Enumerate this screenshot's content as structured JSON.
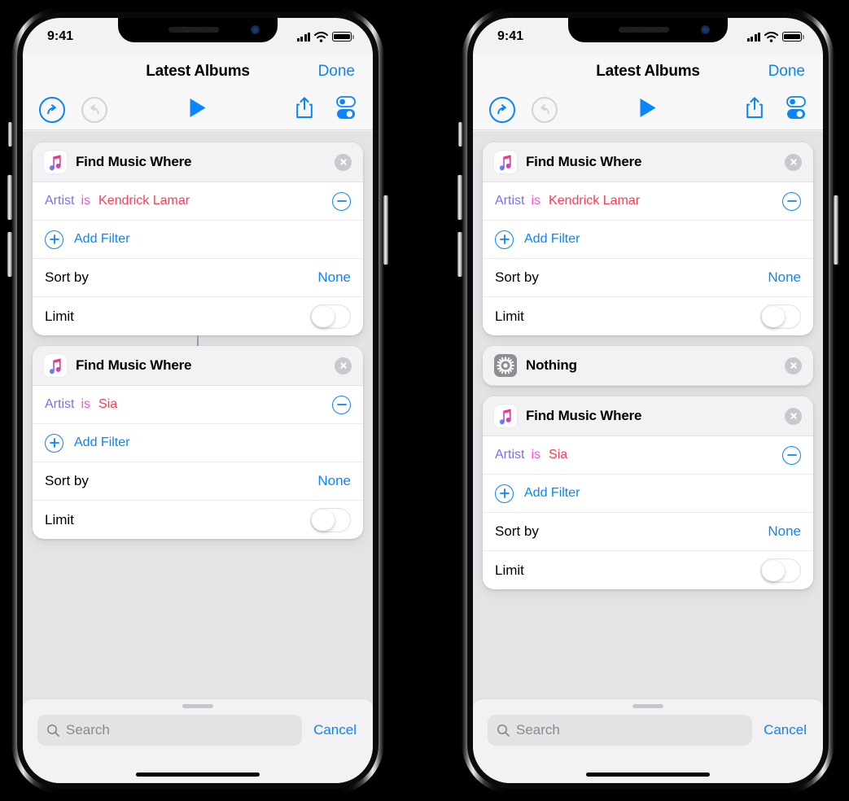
{
  "phones": [
    {
      "id": "left",
      "status_bar": {
        "time": "9:41",
        "cellular": "signal-bars-icon",
        "wifi": "wifi-icon",
        "battery": "battery-full-icon"
      },
      "nav": {
        "title": "Latest Albums",
        "done_label": "Done"
      },
      "toolbar": {
        "undo": "undo-icon",
        "redo": "redo-icon",
        "play": "play-icon",
        "share": "share-icon",
        "settings": "toggles-icon"
      },
      "cards": [
        {
          "type": "music",
          "icon": "apple-music-icon",
          "title": "Find Music Where",
          "close": "close-icon",
          "filters": [
            {
              "attribute": "Artist",
              "operator": "is",
              "value": "Kendrick Lamar",
              "remove": "minus-icon"
            }
          ],
          "add_filter": {
            "icon": "plus-icon",
            "label": "Add Filter"
          },
          "sort": {
            "label": "Sort by",
            "value": "None"
          },
          "limit": {
            "label": "Limit",
            "toggle": "off"
          },
          "connector_below": true
        },
        {
          "type": "music",
          "icon": "apple-music-icon",
          "title": "Find Music Where",
          "close": "close-icon",
          "filters": [
            {
              "attribute": "Artist",
              "operator": "is",
              "value": "Sia",
              "remove": "minus-icon"
            }
          ],
          "add_filter": {
            "icon": "plus-icon",
            "label": "Add Filter"
          },
          "sort": {
            "label": "Sort by",
            "value": "None"
          },
          "limit": {
            "label": "Limit",
            "toggle": "off"
          },
          "connector_below": false
        }
      ],
      "bottom": {
        "search_placeholder": "Search",
        "search_icon": "search-icon",
        "cancel_label": "Cancel",
        "grabber": "drag-handle"
      }
    },
    {
      "id": "right",
      "status_bar": {
        "time": "9:41",
        "cellular": "signal-bars-icon",
        "wifi": "wifi-icon",
        "battery": "battery-full-icon"
      },
      "nav": {
        "title": "Latest Albums",
        "done_label": "Done"
      },
      "toolbar": {
        "undo": "undo-icon",
        "redo": "redo-icon",
        "play": "play-icon",
        "share": "share-icon",
        "settings": "toggles-icon"
      },
      "cards": [
        {
          "type": "music",
          "icon": "apple-music-icon",
          "title": "Find Music Where",
          "close": "close-icon",
          "filters": [
            {
              "attribute": "Artist",
              "operator": "is",
              "value": "Kendrick Lamar",
              "remove": "minus-icon"
            }
          ],
          "add_filter": {
            "icon": "plus-icon",
            "label": "Add Filter"
          },
          "sort": {
            "label": "Sort by",
            "value": "None"
          },
          "limit": {
            "label": "Limit",
            "toggle": "off"
          },
          "connector_below": false
        },
        {
          "type": "nothing",
          "icon": "gear-icon",
          "title": "Nothing",
          "close": "close-icon",
          "connector_below": false
        },
        {
          "type": "music",
          "icon": "apple-music-icon",
          "title": "Find Music Where",
          "close": "close-icon",
          "filters": [
            {
              "attribute": "Artist",
              "operator": "is",
              "value": "Sia",
              "remove": "minus-icon"
            }
          ],
          "add_filter": {
            "icon": "plus-icon",
            "label": "Add Filter"
          },
          "sort": {
            "label": "Sort by",
            "value": "None"
          },
          "limit": {
            "label": "Limit",
            "toggle": "off"
          },
          "connector_below": false
        }
      ],
      "bottom": {
        "search_placeholder": "Search",
        "search_icon": "search-icon",
        "cancel_label": "Cancel",
        "grabber": "drag-handle"
      }
    }
  ],
  "colors": {
    "accent_blue": "#0a84ff",
    "attribute_purple": "#7a6ff0",
    "operator_pink": "#ff4fd0",
    "value_red": "#ff3b52",
    "screen_bg": "#e4e4e7",
    "chrome_bg": "#f2f2f4",
    "card_bg": "#ffffff",
    "gear_tile": "#8e8e93"
  }
}
